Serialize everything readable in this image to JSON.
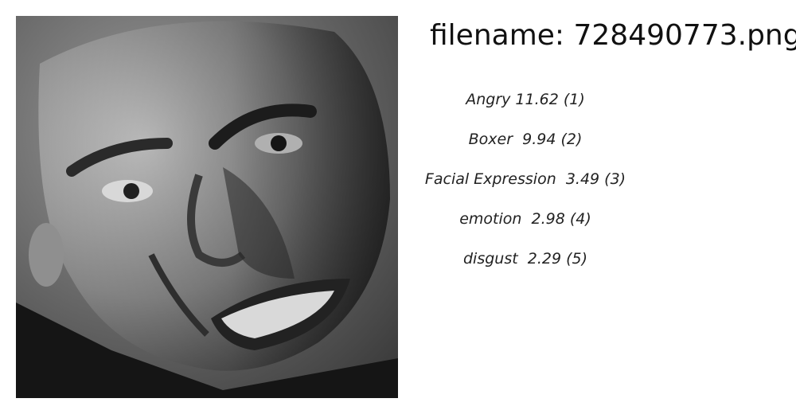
{
  "filename_line": "filename: 728490773.png",
  "image": {
    "alt_icon": "face-photo"
  },
  "labels": [
    {
      "text": "Angry 11.62 (1)"
    },
    {
      "text": "Boxer  9.94 (2)"
    },
    {
      "text": "Facial Expression  3.49 (3)"
    },
    {
      "text": "emotion  2.98 (4)"
    },
    {
      "text": "disgust  2.29 (5)"
    }
  ]
}
